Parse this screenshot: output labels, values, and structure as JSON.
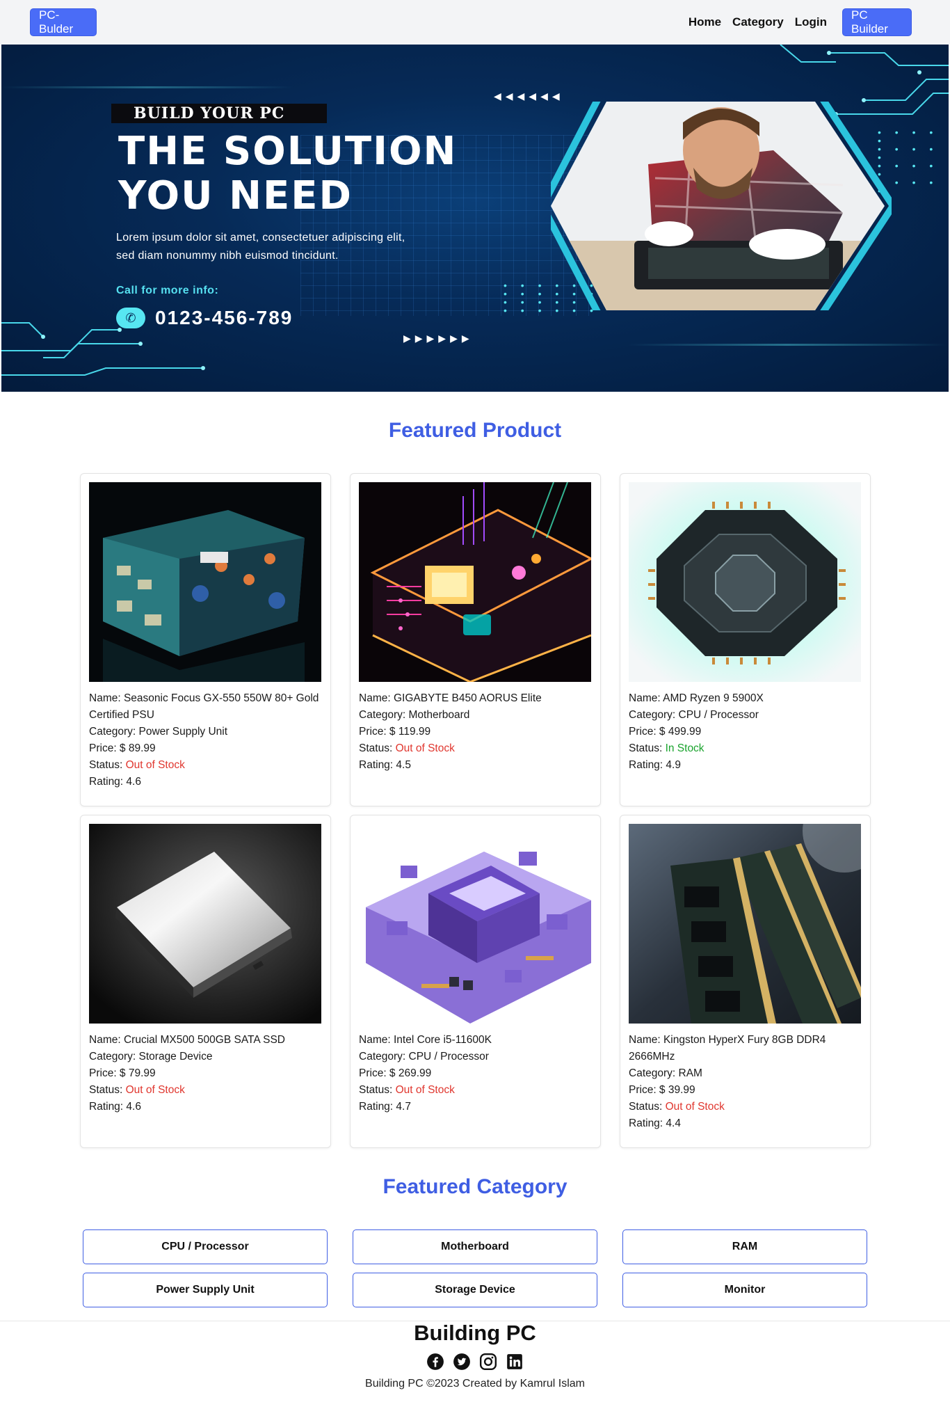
{
  "navbar": {
    "brand": "PC-Bulder",
    "links": [
      "Home",
      "Category",
      "Login"
    ],
    "cta": "PC Builder"
  },
  "hero": {
    "eyebrow": "BUILD YOUR PC",
    "title_line1": "THE SOLUTION",
    "title_line2": "YOU NEED",
    "desc_line1": "Lorem ipsum dolor sit amet, consectetuer adipiscing elit,",
    "desc_line2": "sed diam nonummy nibh euismod tincidunt.",
    "cta_label": "Call for more info:",
    "phone": "0123-456-789"
  },
  "featured_product": {
    "title": "Featured Product",
    "labels": {
      "name": "Name: ",
      "category": "Category: ",
      "price": "Price: $ ",
      "status": "Status: ",
      "rating": "Rating: "
    },
    "products": [
      {
        "name": "Seasonic Focus GX-550 550W 80+ Gold Certified PSU",
        "category": "Power Supply Unit",
        "price": "89.99",
        "status": "Out of Stock",
        "rating": "4.6",
        "image": "psu-image"
      },
      {
        "name": "GIGABYTE B450 AORUS Elite",
        "category": "Motherboard",
        "price": "119.99",
        "status": "Out of Stock",
        "rating": "4.5",
        "image": "motherboard-image"
      },
      {
        "name": "AMD Ryzen 9 5900X",
        "category": "CPU / Processor",
        "price": "499.99",
        "status": "In Stock",
        "rating": "4.9",
        "image": "cpu-image"
      },
      {
        "name": "Crucial MX500 500GB SATA SSD",
        "category": "Storage Device",
        "price": "79.99",
        "status": "Out of Stock",
        "rating": "4.6",
        "image": "ssd-image"
      },
      {
        "name": "Intel Core i5-11600K",
        "category": "CPU / Processor",
        "price": "269.99",
        "status": "Out of Stock",
        "rating": "4.7",
        "image": "cpu-image"
      },
      {
        "name": "Kingston HyperX Fury 8GB DDR4 2666MHz",
        "category": "RAM",
        "price": "39.99",
        "status": "Out of Stock",
        "rating": "4.4",
        "image": "ram-image"
      }
    ]
  },
  "featured_category": {
    "title": "Featured Category",
    "items": [
      "CPU / Processor",
      "Motherboard",
      "RAM",
      "Power Supply Unit",
      "Storage Device",
      "Monitor"
    ]
  },
  "footer": {
    "title": "Building PC",
    "socials": [
      "facebook-icon",
      "twitter-icon",
      "instagram-icon",
      "linkedin-icon"
    ],
    "copyright": "Building PC ©2023 Created by Kamrul Islam"
  },
  "colors": {
    "accent": "#4a6cf7",
    "heading": "#3f5ee3",
    "out_of_stock": "#e0362e",
    "in_stock": "#1aa32d",
    "hero_bg": "#062a57",
    "hero_cyan": "#57e6f2"
  }
}
